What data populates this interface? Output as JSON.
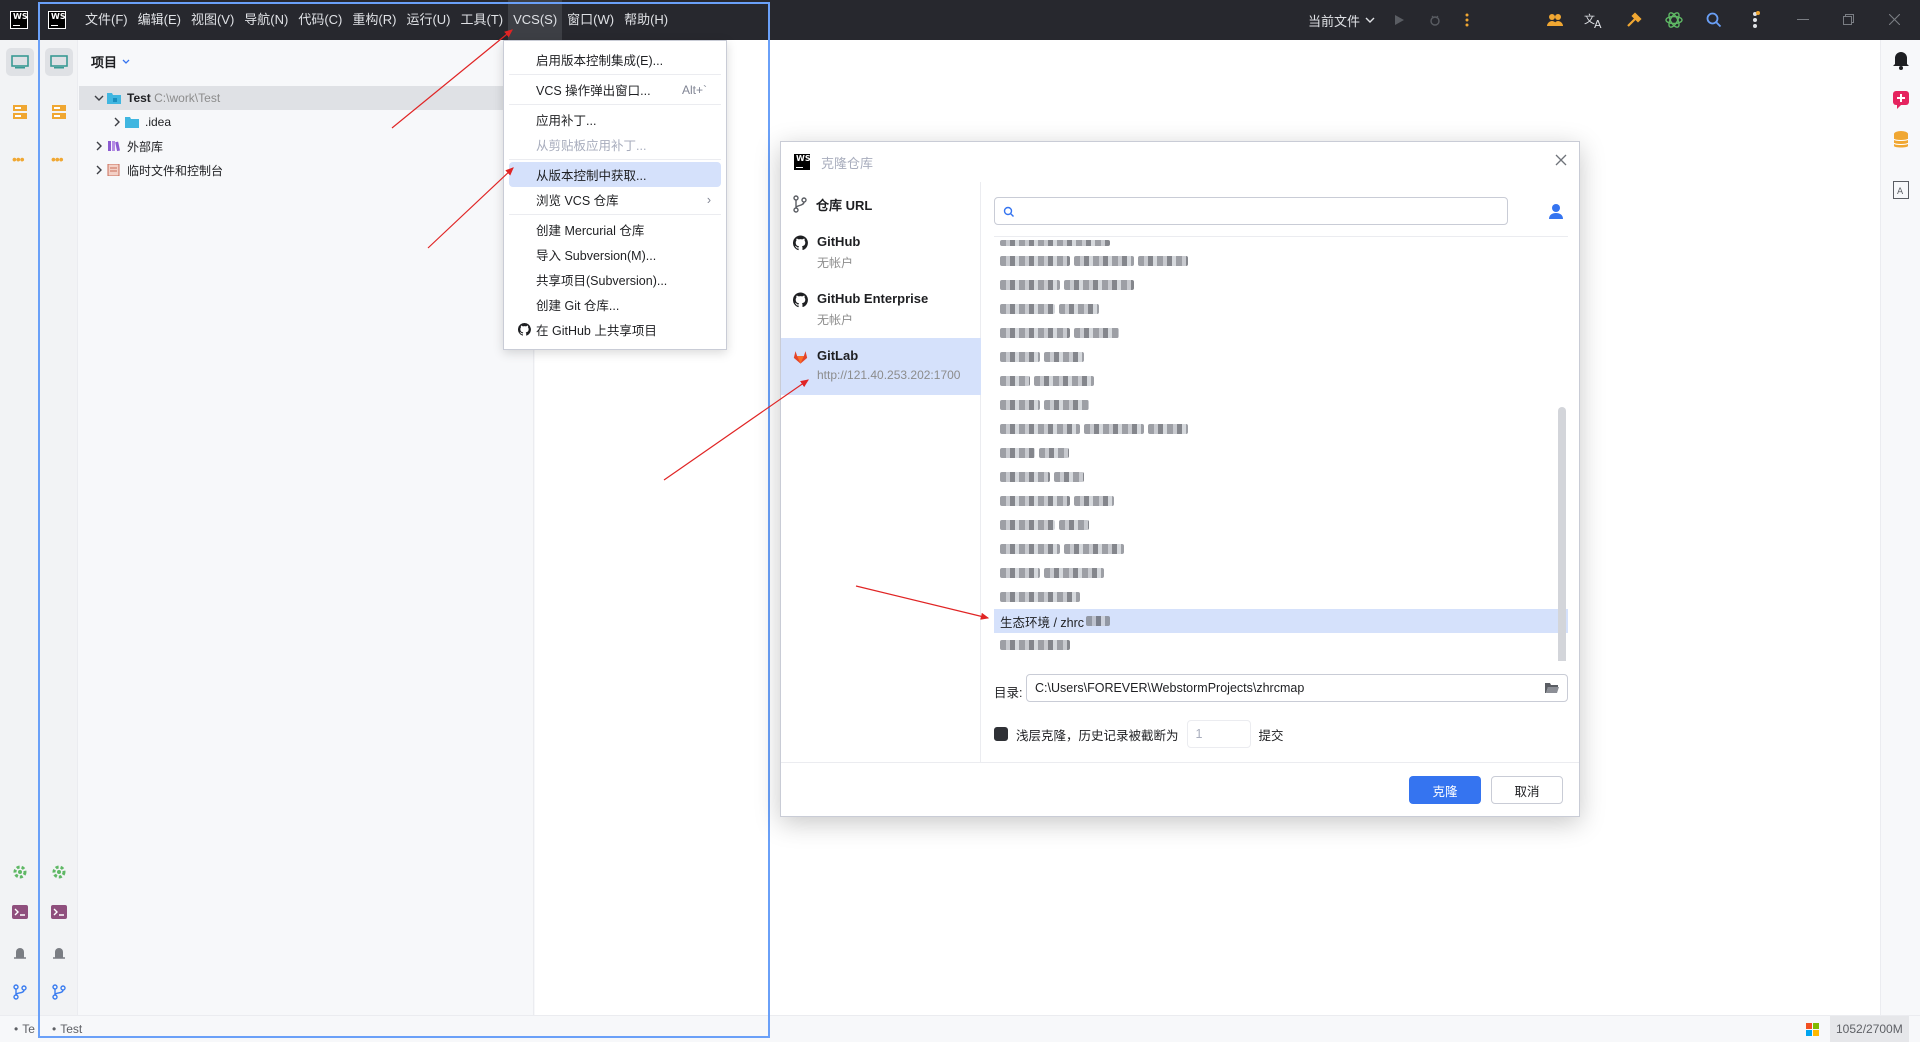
{
  "app": {
    "logo_text": "WS",
    "menu": [
      "文件(F)",
      "编辑(E)",
      "视图(V)",
      "导航(N)",
      "代码(C)",
      "重构(R)",
      "运行(U)",
      "工具(T)",
      "VCS(S)",
      "窗口(W)",
      "帮助(H)"
    ],
    "active_menu": "VCS(S)",
    "run_config": "当前文件",
    "accent_color": "#3574f0"
  },
  "project": {
    "header": "项目",
    "tree": [
      {
        "name": "Test",
        "path": "C:\\work\\Test"
      },
      {
        "name": ".idea"
      },
      {
        "name": "外部库"
      },
      {
        "name": "临时文件和控制台"
      }
    ]
  },
  "vcs_menu": {
    "items": [
      {
        "label": "启用版本控制集成(E)..."
      },
      {
        "label": "VCS 操作弹出窗口...",
        "shortcut": "Alt+`"
      },
      {
        "label": "应用补丁..."
      },
      {
        "label": "从剪贴板应用补丁..."
      },
      {
        "label": "从版本控制中获取..."
      },
      {
        "label": "浏览 VCS 仓库"
      },
      {
        "label": "创建 Mercurial 仓库"
      },
      {
        "label": "导入 Subversion(M)..."
      },
      {
        "label": "共享项目(Subversion)..."
      },
      {
        "label": "创建 Git 仓库..."
      },
      {
        "label": "在 GitHub 上共享项目"
      }
    ]
  },
  "clone_dialog": {
    "title": "克隆仓库",
    "providers": [
      {
        "name": "仓库 URL",
        "sub": ""
      },
      {
        "name": "GitHub",
        "sub": "无帐户"
      },
      {
        "name": "GitHub Enterprise",
        "sub": "无帐户"
      },
      {
        "name": "GitLab",
        "sub": "http://121.40.253.202:1700"
      }
    ],
    "selected_repo": "生态环境 / zhrc",
    "dir_label": "目录:",
    "dir_value": "C:\\Users\\FOREVER\\WebstormProjects\\zhrcmap",
    "shallow_label": "浅层克隆，历史记录被截断为",
    "shallow_depth": "1",
    "shallow_suffix": "提交",
    "clone_button": "克隆",
    "cancel_button": "取消"
  },
  "status": {
    "project_name": "Test",
    "project_name_prefix": "Te",
    "memory": "1052/2700M"
  }
}
